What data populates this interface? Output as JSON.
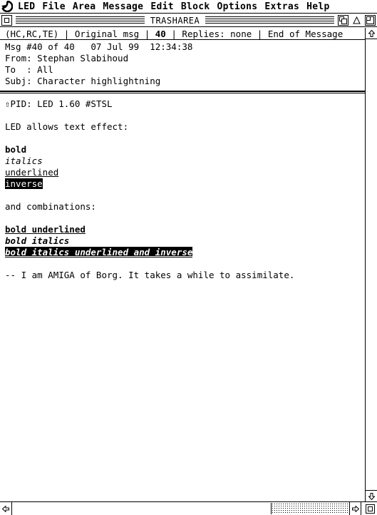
{
  "menubar": {
    "logo_icon": "amiga-logo-icon",
    "items": [
      "LED",
      "File",
      "Area",
      "Message",
      "Edit",
      "Block",
      "Options",
      "Extras",
      "Help"
    ]
  },
  "window": {
    "title": "TRASHAREA"
  },
  "status": {
    "flags": "(HC,RC,TE)",
    "sep1": "|",
    "original": "Original msg",
    "sep2": "|",
    "msg_number": "40",
    "sep3": "|",
    "replies": "Replies: none",
    "sep4": "|",
    "end": "End of Message"
  },
  "header": {
    "msg_line": "Msg #40 of 40   07 Jul 99  12:34:38",
    "from_line": "From: Stephan Slabihoud",
    "to_line": "To  : All",
    "subj_line": "Subj: Character highlightning"
  },
  "body": {
    "pid_arrow": "⇧",
    "pid": "PID: LED 1.60 #STSL",
    "intro": "LED allows text effect:",
    "bold": "bold",
    "italics": "italics",
    "underlined": "underlined",
    "inverse": "inverse",
    "combinations": "and combinations:",
    "bold_underlined": "bold underlined",
    "bold_italics": "bold italics",
    "all_combined": "bold italics underlined and inverse",
    "tagline": "-- I am AMIGA of Borg. It takes a while to assimilate."
  }
}
